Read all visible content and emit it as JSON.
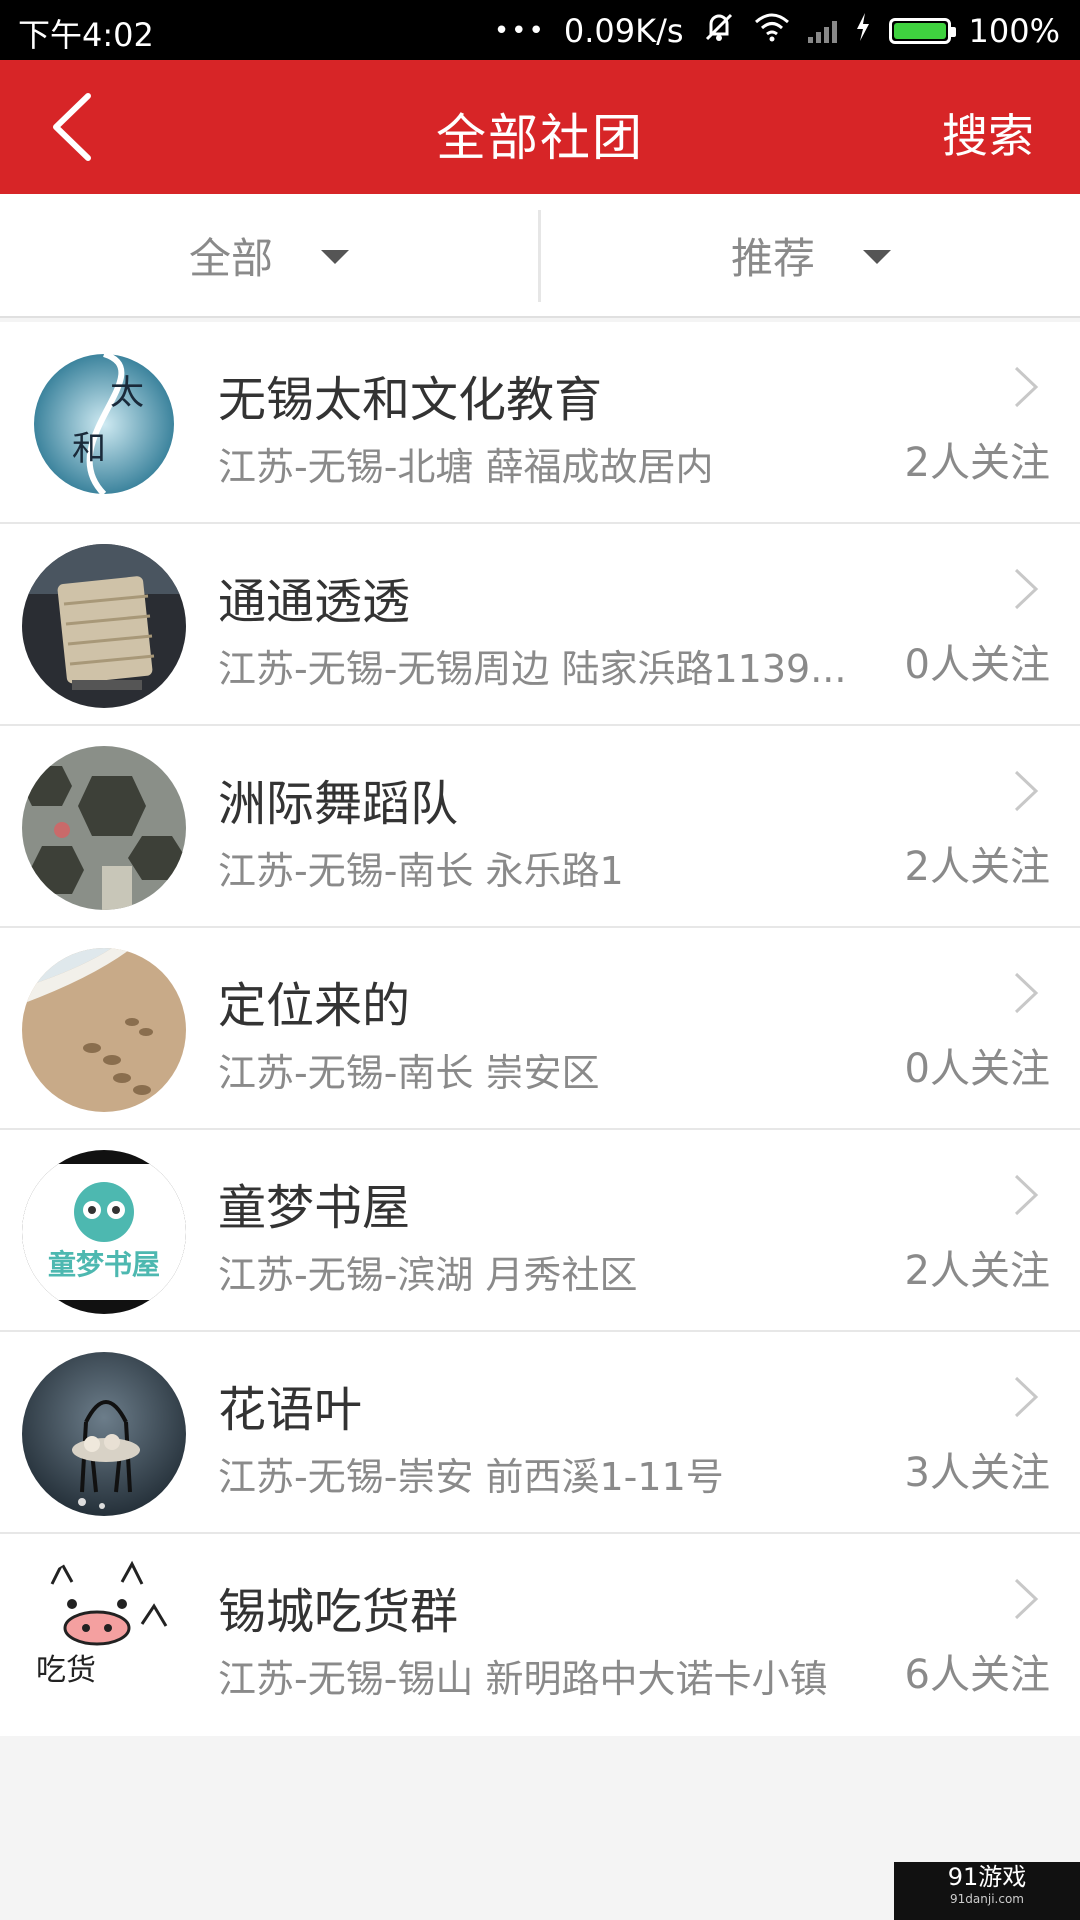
{
  "status_bar": {
    "time": "下午4:02",
    "dots": "•••",
    "speed": "0.09K/s",
    "battery": "100%"
  },
  "header": {
    "title": "全部社团",
    "search_label": "搜索"
  },
  "filters": {
    "category": "全部",
    "sort": "推荐"
  },
  "clubs": [
    {
      "name": "无锡太和文化教育",
      "address": "江苏-无锡-北塘 薛福成故居内",
      "followers": "2人关注"
    },
    {
      "name": "通通透透",
      "address": "江苏-无锡-无锡周边 陆家浜路1139...",
      "followers": "0人关注"
    },
    {
      "name": "洲际舞蹈队",
      "address": "江苏-无锡-南长 永乐路1",
      "followers": "2人关注"
    },
    {
      "name": "定位来的",
      "address": "江苏-无锡-南长 崇安区",
      "followers": "0人关注"
    },
    {
      "name": "童梦书屋",
      "address": "江苏-无锡-滨湖 月秀社区",
      "followers": "2人关注"
    },
    {
      "name": "花语叶",
      "address": "江苏-无锡-崇安 前西溪1-11号",
      "followers": "3人关注"
    },
    {
      "name": "锡城吃货群",
      "address": "江苏-无锡-锡山 新明路中大诺卡小镇",
      "followers": "6人关注"
    }
  ],
  "avatar_text": {
    "taihe_1": "太",
    "taihe_2": "和",
    "tongmeng": "童梦书屋",
    "chihuo": "吃货"
  },
  "watermark": {
    "brand": "91游戏",
    "site": "91danji.com"
  },
  "colors": {
    "header_bg": "#d72527",
    "battery_fill": "#3fd13f"
  }
}
